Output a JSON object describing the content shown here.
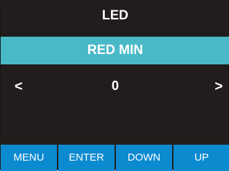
{
  "screen": {
    "title": "LED",
    "header": "RED MIN",
    "value": "0",
    "arrow_left": "<",
    "arrow_right": ">"
  },
  "buttons": [
    "MENU",
    "ENTER",
    "DOWN",
    "UP"
  ],
  "colors": {
    "background": "#211d1c",
    "header_bar": "#49b9c8",
    "button": "#0c8ad0",
    "text": "#ffffff"
  }
}
